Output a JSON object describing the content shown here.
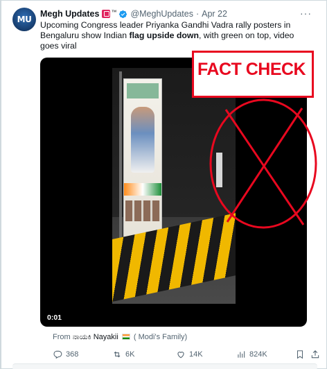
{
  "tweet": {
    "avatar_text": "MU",
    "author_name": "Megh Updates",
    "badge_tm": "™",
    "handle": "@MeghUpdates",
    "separator": "·",
    "date": "Apr 22",
    "more_label": "···",
    "text_plain_1": "Upcoming Congress leader Priyanka Gandhi Vadra rally posters in Bengaluru show Indian ",
    "text_bold": "flag upside down",
    "text_plain_2": ", with green on top, video goes viral",
    "video_time": "0:01",
    "overlay_label": "FACT CHECK",
    "from_prefix": "From",
    "from_author": "ನಾಯಕಿ Nayakii",
    "from_suffix": "( Modi's Family)",
    "replies": "368",
    "reposts": "6K",
    "likes": "14K",
    "views": "824K"
  },
  "colors": {
    "accent_blue": "#1d9bf0",
    "fact_red": "#e8081f",
    "muted": "#536471"
  }
}
